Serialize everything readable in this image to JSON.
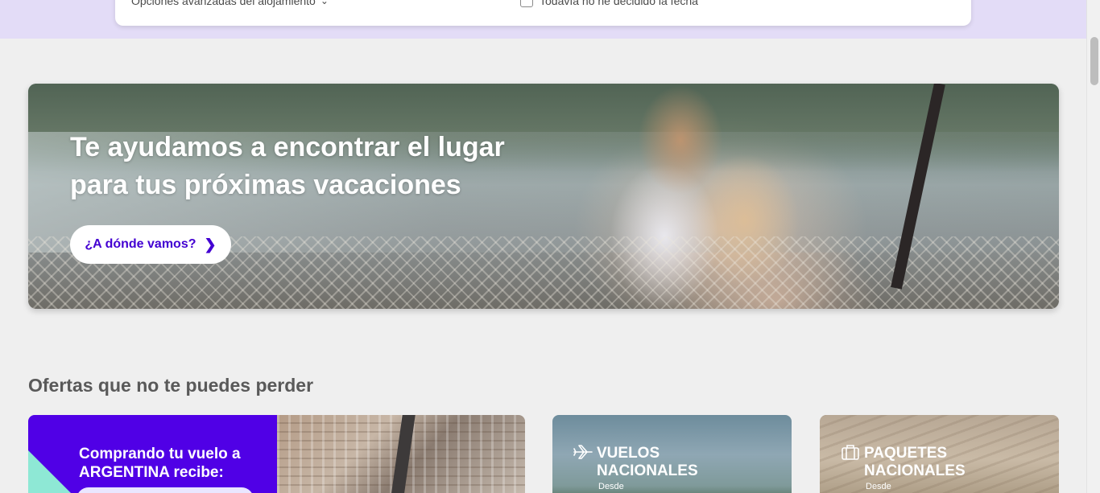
{
  "search": {
    "advanced_options": "Opciones avanzadas del alojamiento",
    "no_date": "Todavía no he decidido la fecha"
  },
  "hero": {
    "title_line1": "Te ayudamos a encontrar el lugar",
    "title_line2": "para tus próximas vacaciones",
    "cta_label": "¿A dónde vamos?"
  },
  "offers": {
    "section_title": "Ofertas que no te puedes perder",
    "promo": {
      "line1": "Comprando tu vuelo a",
      "line2": "ARGENTINA recibe:"
    },
    "cards": [
      {
        "line1": "VUELOS",
        "line2": "NACIONALES",
        "desde": "Desde",
        "icon": "plane-icon"
      },
      {
        "line1": "PAQUETES",
        "line2": "NACIONALES",
        "desde": "Desde",
        "icon": "suitcase-icon"
      }
    ]
  },
  "colors": {
    "brand": "#4300d2",
    "promo_bg": "#5000e6",
    "top_band": "#e3dcf7",
    "accent_mint": "#8ee8d5"
  }
}
